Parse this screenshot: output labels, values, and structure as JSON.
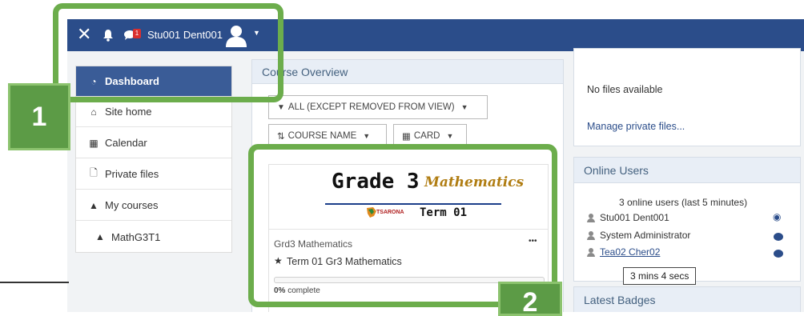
{
  "topbar": {
    "user_name": "Stu001 Dent001",
    "message_count": "1",
    "icons": [
      "close-icon",
      "bell-icon",
      "chat-icon",
      "avatar",
      "chevron-down-icon"
    ]
  },
  "sidebar": {
    "items": [
      {
        "label": "Dashboard",
        "icon": "tachometer-icon",
        "active": true
      },
      {
        "label": "Site home",
        "icon": "home-icon"
      },
      {
        "label": "Calendar",
        "icon": "calendar-icon"
      },
      {
        "label": "Private files",
        "icon": "file-icon"
      },
      {
        "label": "My courses",
        "icon": "graduation-cap-icon"
      },
      {
        "label": "MathG3T1",
        "icon": "graduation-cap-icon"
      }
    ]
  },
  "course_overview": {
    "title": "Course Overview",
    "filter_label": "ALL (EXCEPT REMOVED FROM VIEW)",
    "sort_label": "COURSE NAME",
    "view_label": "CARD",
    "card": {
      "banner_title": "Grade 3",
      "banner_subject": "Mathematics",
      "banner_logo_text": "TSARONA",
      "banner_term": "Term 01",
      "category": "Grd3 Mathematics",
      "course_name": "Term 01 Gr3 Mathematics",
      "menu_label": "•••",
      "progress_percent": "0%",
      "progress_suffix": " complete",
      "progress_value": 0
    }
  },
  "private_files": {
    "empty_text": "No files available",
    "manage_link": "Manage private files..."
  },
  "online_users": {
    "title": "Online Users",
    "summary": "3 online users (last 5 minutes)",
    "users": [
      {
        "name": "Stu001 Dent001",
        "action_icon": "eye-icon"
      },
      {
        "name": "System Administrator",
        "action_icon": "chat-icon"
      },
      {
        "name": "Tea02 Cher02",
        "action_icon": "chat-icon"
      }
    ],
    "tooltip": "3 mins 4 secs"
  },
  "latest_badges": {
    "title": "Latest Badges"
  },
  "annotations": {
    "label_1": "1",
    "label_2": "2"
  }
}
